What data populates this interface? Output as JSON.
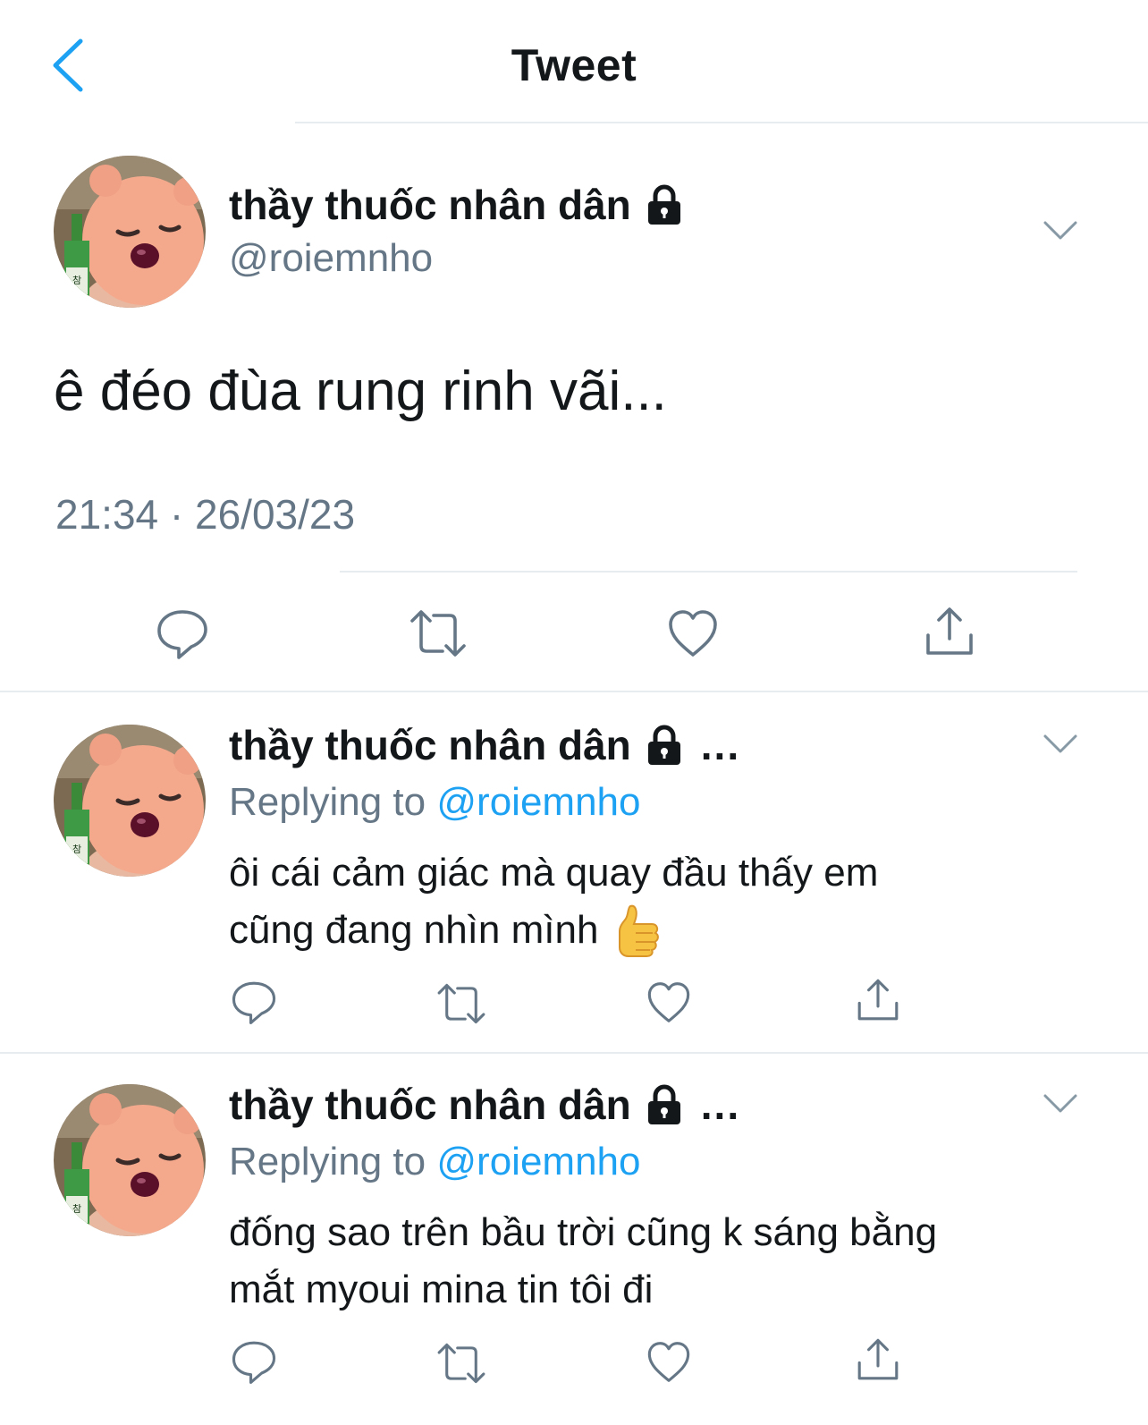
{
  "header": {
    "title": "Tweet",
    "back_icon": "chevron-left-icon",
    "accent": "#1da1f2"
  },
  "main_tweet": {
    "display_name": "thầy thuốc nhân dân",
    "handle": "@roiemnho",
    "text": "ê đéo đùa rung rinh vãi...",
    "timestamp": "21:34 · 26/03/23"
  },
  "replies": [
    {
      "display_name": "thầy thuốc nhân dân",
      "more": "...",
      "replying_prefix": "Replying to",
      "replying_handle": "@roiemnho",
      "text_line1": "ôi cái cảm giác mà quay đầu thấy em",
      "text_line2": "cũng đang nhìn mình",
      "emoji": "thumbs-up"
    },
    {
      "display_name": "thầy thuốc nhân dân",
      "more": "...",
      "replying_prefix": "Replying to",
      "replying_handle": "@roiemnho",
      "text_line1": "đống sao trên bầu trời cũng k sáng bằng",
      "text_line2": "mắt myoui mina tin tôi đi"
    }
  ],
  "colors": {
    "text": "#14171a",
    "secondary": "#657786",
    "link": "#1da1f2",
    "divider": "#e6ecf0"
  }
}
